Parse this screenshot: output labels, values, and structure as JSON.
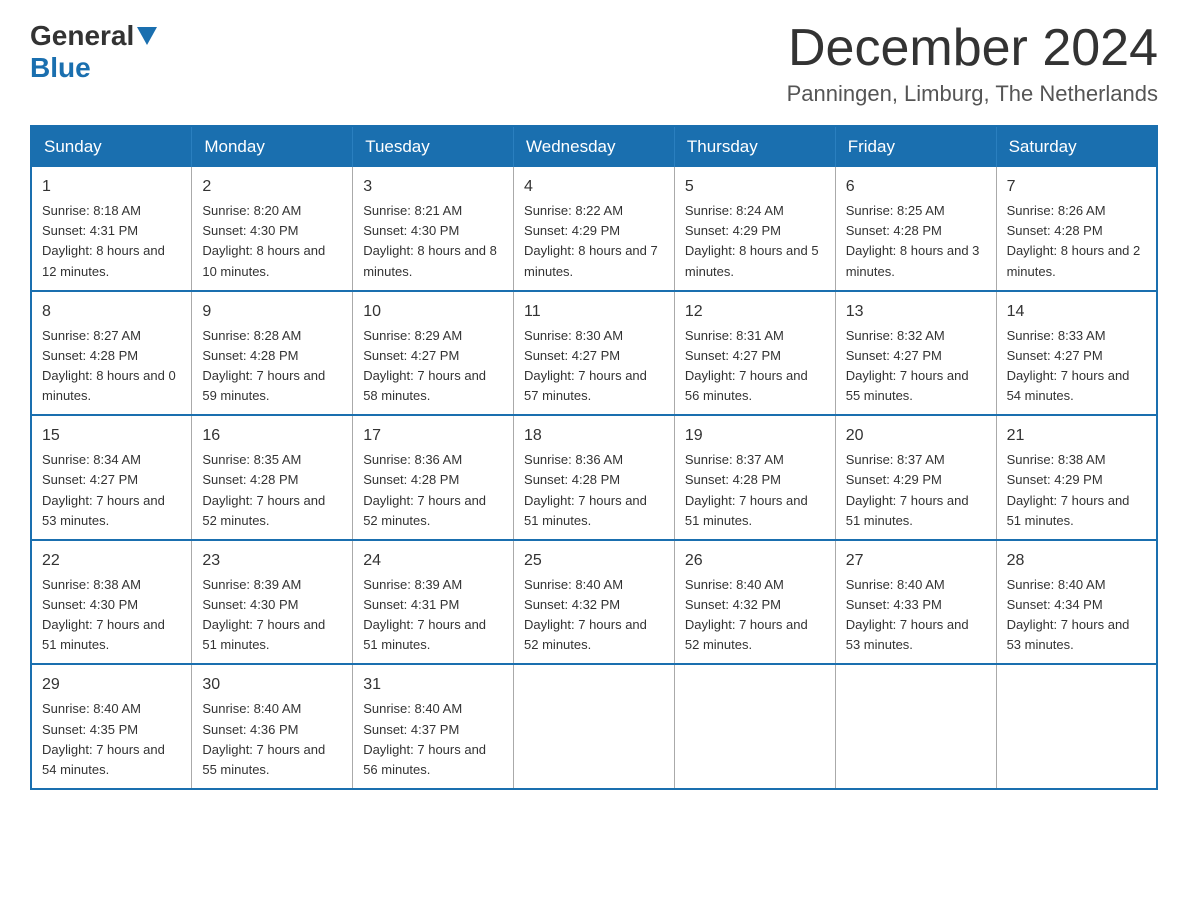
{
  "header": {
    "logo_general": "General",
    "logo_blue": "Blue",
    "month_title": "December 2024",
    "subtitle": "Panningen, Limburg, The Netherlands"
  },
  "weekdays": [
    "Sunday",
    "Monday",
    "Tuesday",
    "Wednesday",
    "Thursday",
    "Friday",
    "Saturday"
  ],
  "weeks": [
    [
      {
        "day": "1",
        "sunrise": "8:18 AM",
        "sunset": "4:31 PM",
        "daylight": "8 hours and 12 minutes."
      },
      {
        "day": "2",
        "sunrise": "8:20 AM",
        "sunset": "4:30 PM",
        "daylight": "8 hours and 10 minutes."
      },
      {
        "day": "3",
        "sunrise": "8:21 AM",
        "sunset": "4:30 PM",
        "daylight": "8 hours and 8 minutes."
      },
      {
        "day": "4",
        "sunrise": "8:22 AM",
        "sunset": "4:29 PM",
        "daylight": "8 hours and 7 minutes."
      },
      {
        "day": "5",
        "sunrise": "8:24 AM",
        "sunset": "4:29 PM",
        "daylight": "8 hours and 5 minutes."
      },
      {
        "day": "6",
        "sunrise": "8:25 AM",
        "sunset": "4:28 PM",
        "daylight": "8 hours and 3 minutes."
      },
      {
        "day": "7",
        "sunrise": "8:26 AM",
        "sunset": "4:28 PM",
        "daylight": "8 hours and 2 minutes."
      }
    ],
    [
      {
        "day": "8",
        "sunrise": "8:27 AM",
        "sunset": "4:28 PM",
        "daylight": "8 hours and 0 minutes."
      },
      {
        "day": "9",
        "sunrise": "8:28 AM",
        "sunset": "4:28 PM",
        "daylight": "7 hours and 59 minutes."
      },
      {
        "day": "10",
        "sunrise": "8:29 AM",
        "sunset": "4:27 PM",
        "daylight": "7 hours and 58 minutes."
      },
      {
        "day": "11",
        "sunrise": "8:30 AM",
        "sunset": "4:27 PM",
        "daylight": "7 hours and 57 minutes."
      },
      {
        "day": "12",
        "sunrise": "8:31 AM",
        "sunset": "4:27 PM",
        "daylight": "7 hours and 56 minutes."
      },
      {
        "day": "13",
        "sunrise": "8:32 AM",
        "sunset": "4:27 PM",
        "daylight": "7 hours and 55 minutes."
      },
      {
        "day": "14",
        "sunrise": "8:33 AM",
        "sunset": "4:27 PM",
        "daylight": "7 hours and 54 minutes."
      }
    ],
    [
      {
        "day": "15",
        "sunrise": "8:34 AM",
        "sunset": "4:27 PM",
        "daylight": "7 hours and 53 minutes."
      },
      {
        "day": "16",
        "sunrise": "8:35 AM",
        "sunset": "4:28 PM",
        "daylight": "7 hours and 52 minutes."
      },
      {
        "day": "17",
        "sunrise": "8:36 AM",
        "sunset": "4:28 PM",
        "daylight": "7 hours and 52 minutes."
      },
      {
        "day": "18",
        "sunrise": "8:36 AM",
        "sunset": "4:28 PM",
        "daylight": "7 hours and 51 minutes."
      },
      {
        "day": "19",
        "sunrise": "8:37 AM",
        "sunset": "4:28 PM",
        "daylight": "7 hours and 51 minutes."
      },
      {
        "day": "20",
        "sunrise": "8:37 AM",
        "sunset": "4:29 PM",
        "daylight": "7 hours and 51 minutes."
      },
      {
        "day": "21",
        "sunrise": "8:38 AM",
        "sunset": "4:29 PM",
        "daylight": "7 hours and 51 minutes."
      }
    ],
    [
      {
        "day": "22",
        "sunrise": "8:38 AM",
        "sunset": "4:30 PM",
        "daylight": "7 hours and 51 minutes."
      },
      {
        "day": "23",
        "sunrise": "8:39 AM",
        "sunset": "4:30 PM",
        "daylight": "7 hours and 51 minutes."
      },
      {
        "day": "24",
        "sunrise": "8:39 AM",
        "sunset": "4:31 PM",
        "daylight": "7 hours and 51 minutes."
      },
      {
        "day": "25",
        "sunrise": "8:40 AM",
        "sunset": "4:32 PM",
        "daylight": "7 hours and 52 minutes."
      },
      {
        "day": "26",
        "sunrise": "8:40 AM",
        "sunset": "4:32 PM",
        "daylight": "7 hours and 52 minutes."
      },
      {
        "day": "27",
        "sunrise": "8:40 AM",
        "sunset": "4:33 PM",
        "daylight": "7 hours and 53 minutes."
      },
      {
        "day": "28",
        "sunrise": "8:40 AM",
        "sunset": "4:34 PM",
        "daylight": "7 hours and 53 minutes."
      }
    ],
    [
      {
        "day": "29",
        "sunrise": "8:40 AM",
        "sunset": "4:35 PM",
        "daylight": "7 hours and 54 minutes."
      },
      {
        "day": "30",
        "sunrise": "8:40 AM",
        "sunset": "4:36 PM",
        "daylight": "7 hours and 55 minutes."
      },
      {
        "day": "31",
        "sunrise": "8:40 AM",
        "sunset": "4:37 PM",
        "daylight": "7 hours and 56 minutes."
      },
      null,
      null,
      null,
      null
    ]
  ]
}
